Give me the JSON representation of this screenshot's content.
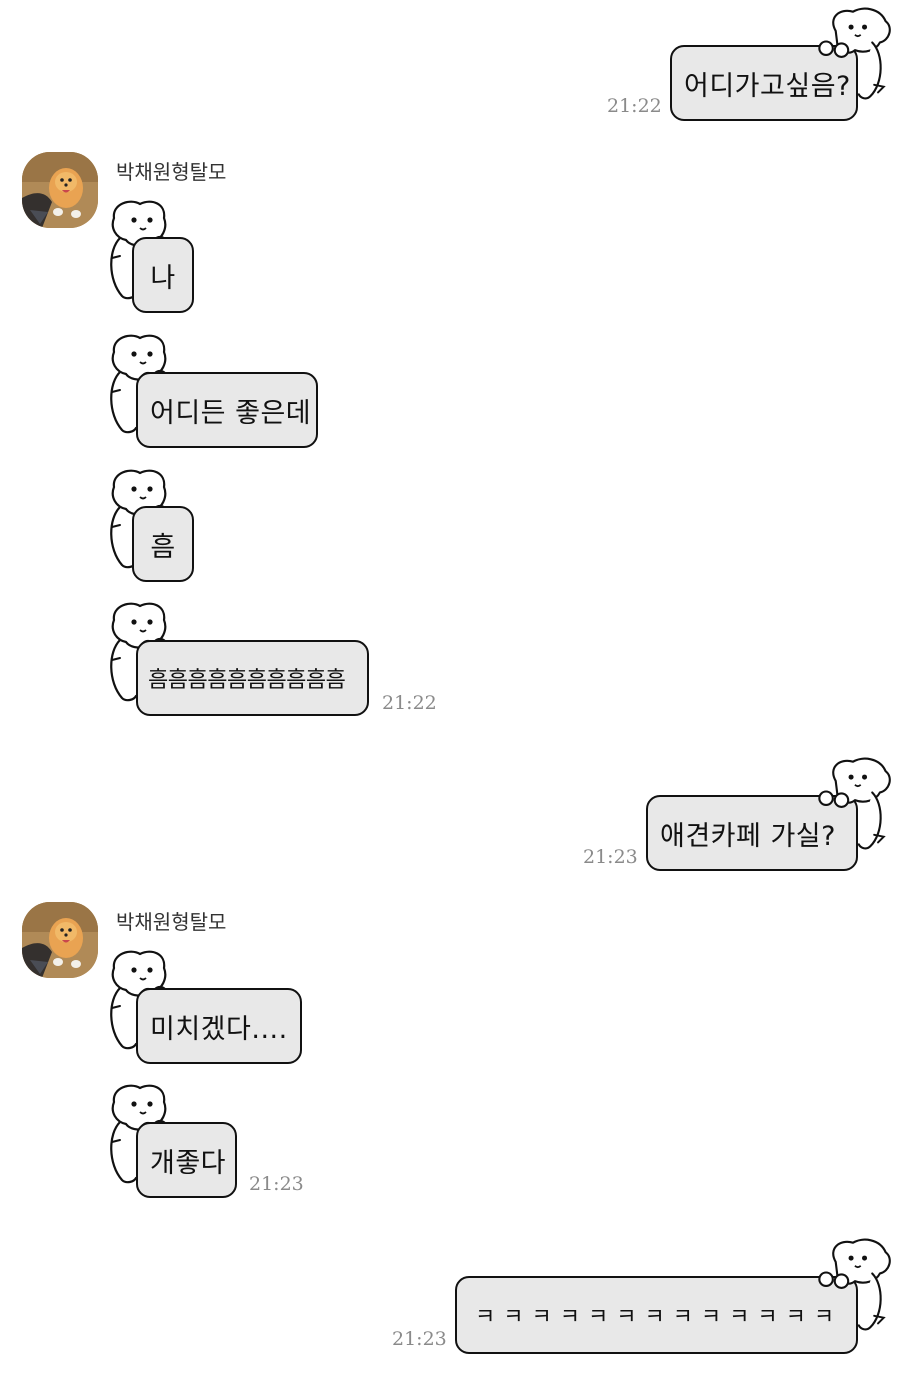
{
  "contact": {
    "name": "박채원형탈모",
    "avatar_icon": "pomeranian-dog-photo"
  },
  "messages": [
    {
      "side": "out",
      "text": "어디가고싶음?",
      "time": "21:22"
    },
    {
      "side": "in",
      "text": "나"
    },
    {
      "side": "in",
      "text": "어디든 좋은데"
    },
    {
      "side": "in",
      "text": "흠"
    },
    {
      "side": "in",
      "text": "흠흠흠흠흠흠흠흠흠흠",
      "time": "21:22"
    },
    {
      "side": "out",
      "text": "애견카페 가실?",
      "time": "21:23"
    },
    {
      "side": "in",
      "text": "미치겠다...."
    },
    {
      "side": "in",
      "text": "개좋다",
      "time": "21:23"
    },
    {
      "side": "out",
      "text": "ㅋㅋㅋㅋㅋㅋㅋㅋㅋㅋㅋㅋㅋ",
      "time": "21:23"
    }
  ],
  "theme": {
    "bubble_color": "#e8e8e8",
    "border_color": "#111111",
    "time_color": "#8a8a8a",
    "bubble_sticker_icon": "white-puppy-sticker-icon"
  }
}
